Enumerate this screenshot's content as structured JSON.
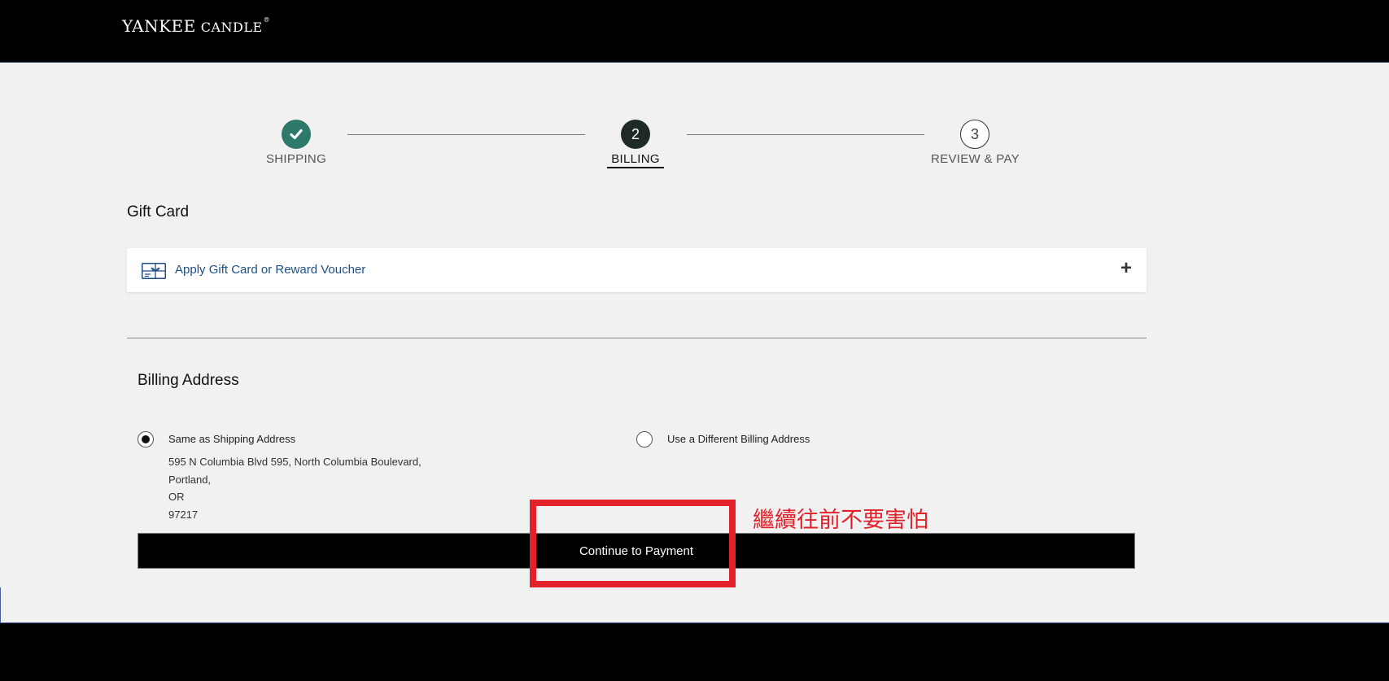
{
  "header": {
    "logo_main": "YANKEE",
    "logo_sub": "CANDLE",
    "logo_tm": "®"
  },
  "stepper": {
    "steps": [
      {
        "number": "",
        "label": "SHIPPING",
        "state": "completed"
      },
      {
        "number": "2",
        "label": "BILLING",
        "state": "active"
      },
      {
        "number": "3",
        "label": "REVIEW & PAY",
        "state": "upcoming"
      }
    ]
  },
  "gift_card": {
    "title": "Gift Card",
    "link_label": "Apply Gift Card or Reward Voucher",
    "icon": "gift-card-icon",
    "expand_icon": "plus-icon"
  },
  "billing": {
    "title": "Billing Address",
    "options": [
      {
        "label": "Same as Shipping Address",
        "checked": true
      },
      {
        "label": "Use a Different Billing Address",
        "checked": false
      }
    ],
    "address": {
      "line1": "595 N Columbia Blvd 595, North Columbia Boulevard,",
      "city": "Portland,",
      "state": "OR",
      "zip": "97217"
    }
  },
  "actions": {
    "continue_label": "Continue to Payment"
  },
  "annotation": {
    "note": "繼續往前不要害怕"
  },
  "colors": {
    "completed_step": "#2e7a6a",
    "active_step": "#1e2a24",
    "link": "#1f4f84",
    "annotation_red": "#e3212b"
  }
}
